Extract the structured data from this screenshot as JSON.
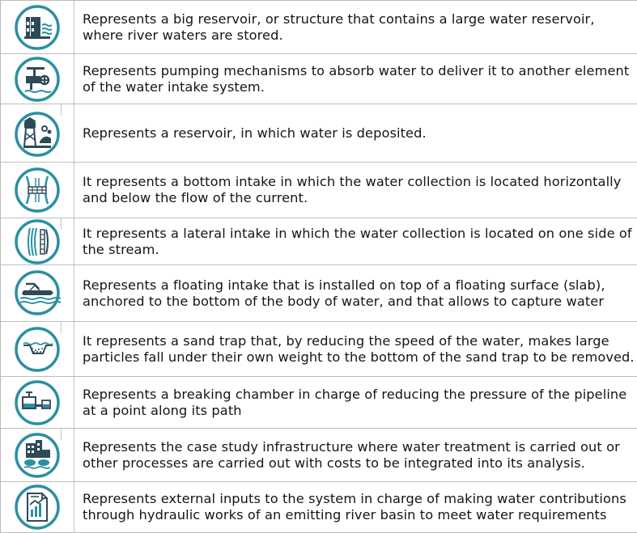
{
  "legend": {
    "rows": [
      {
        "icon": "dam-icon",
        "text": "Represents a big reservoir, or structure that contains a large water reservoir, where river waters are stored."
      },
      {
        "icon": "pump-icon",
        "text": "Represents pumping mechanisms to absorb water to deliver it to another element of the water intake system."
      },
      {
        "icon": "water-tower-icon",
        "text": "Represents a reservoir, in which water is deposited."
      },
      {
        "icon": "bottom-intake-icon",
        "text": "It represents a bottom intake in which the water collection is located horizontally and below the flow of the current."
      },
      {
        "icon": "lateral-intake-icon",
        "text": "It represents a lateral intake in which the water collection is located on one side of the stream."
      },
      {
        "icon": "floating-intake-icon",
        "text": "Represents a floating intake that is installed on top of a floating surface (slab), anchored to the bottom of the body of water, and that allows to capture water"
      },
      {
        "icon": "sand-trap-icon",
        "text": "It represents a sand trap that, by reducing the speed of the water, makes large particles fall under their own weight to the bottom of the sand trap to be removed."
      },
      {
        "icon": "breaking-chamber-icon",
        "text": "Represents a breaking chamber in charge of reducing the pressure of the pipeline at a point along its path"
      },
      {
        "icon": "treatment-plant-icon",
        "text": "Represents the case study infrastructure where water treatment is carried out or other processes are carried out with costs to be integrated into its analysis."
      },
      {
        "icon": "external-input-icon",
        "text": "Represents external inputs to the system in charge of making water contributions through hydraulic works of an emitting river basin to meet water requirements"
      }
    ]
  },
  "colors": {
    "icon_teal": "#2b8fa3",
    "icon_dark": "#2d4a57",
    "border": "#bdbdbd",
    "text": "#151515"
  }
}
